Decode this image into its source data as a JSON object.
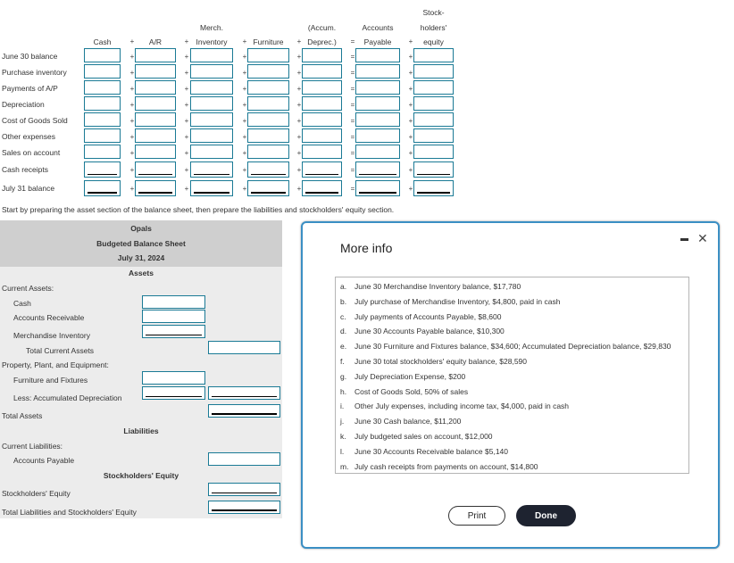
{
  "worksheet": {
    "headers": [
      {
        "lines": [
          "",
          "",
          "Cash"
        ]
      },
      {
        "lines": [
          "",
          "",
          "A/R"
        ]
      },
      {
        "lines": [
          "",
          "Merch.",
          "Inventory"
        ]
      },
      {
        "lines": [
          "",
          "",
          "Furniture"
        ]
      },
      {
        "lines": [
          "",
          "(Accum.",
          "Deprec.)"
        ]
      },
      {
        "lines": [
          "",
          "Accounts",
          "Payable"
        ]
      },
      {
        "lines": [
          "Stock-",
          "holders'",
          "equity"
        ]
      }
    ],
    "operators": [
      "+",
      "+",
      "+",
      "+",
      "=",
      "+"
    ],
    "rows": [
      {
        "label": "June 30 balance"
      },
      {
        "label": "Purchase inventory"
      },
      {
        "label": "Payments of A/P"
      },
      {
        "label": "Depreciation"
      },
      {
        "label": "Cost of Goods Sold"
      },
      {
        "label": "Other expenses"
      },
      {
        "label": "Sales on account"
      },
      {
        "label": "Cash receipts"
      },
      {
        "label": "July 31 balance"
      }
    ],
    "instruction": "Start by preparing the asset section of the balance sheet, then prepare the liabilities and stockholders' equity section."
  },
  "balance_sheet": {
    "company": "Opals",
    "title": "Budgeted Balance Sheet",
    "date": "July 31, 2024",
    "assets_heading": "Assets",
    "current_assets_label": "Current Assets:",
    "cash_label": "Cash",
    "ar_label": "Accounts Receivable",
    "merch_label": "Merchandise Inventory",
    "total_current_label": "Total Current Assets",
    "ppe_label": "Property, Plant, and Equipment:",
    "furniture_label": "Furniture and Fixtures",
    "accum_label": "Less: Accumulated Depreciation",
    "total_assets_label": "Total Assets",
    "liabilities_heading": "Liabilities",
    "current_liab_label": "Current Liabilities:",
    "ap_label": "Accounts Payable",
    "se_heading": "Stockholders' Equity",
    "se_label": "Stockholders' Equity",
    "total_le_label": "Total Liabilities and Stockholders' Equity"
  },
  "modal": {
    "title": "More info",
    "items": [
      {
        "letter": "a.",
        "text": "June 30 Merchandise Inventory balance, $17,780"
      },
      {
        "letter": "b.",
        "text": "July purchase of Merchandise Inventory, $4,800, paid in cash"
      },
      {
        "letter": "c.",
        "text": "July payments of Accounts Payable, $8,600"
      },
      {
        "letter": "d.",
        "text": "June 30 Accounts Payable balance, $10,300"
      },
      {
        "letter": "e.",
        "text": "June 30 Furniture and Fixtures balance, $34,600; Accumulated Depreciation balance, $29,830"
      },
      {
        "letter": "f.",
        "text": "June 30 total stockholders' equity balance, $28,590"
      },
      {
        "letter": "g.",
        "text": "July Depreciation Expense, $200"
      },
      {
        "letter": "h.",
        "text": "Cost of Goods Sold, 50% of sales"
      },
      {
        "letter": "i.",
        "text": "Other July expenses, including income tax, $4,000, paid in cash"
      },
      {
        "letter": "j.",
        "text": "June 30 Cash balance, $11,200"
      },
      {
        "letter": "k.",
        "text": "July budgeted sales on account, $12,000"
      },
      {
        "letter": "l.",
        "text": "June 30 Accounts Receivable balance $5,140"
      },
      {
        "letter": "m.",
        "text": "July cash receipts from payments on account, $14,800"
      }
    ],
    "print_label": "Print",
    "done_label": "Done",
    "minimize_icon": "minimize-icon",
    "close_icon": "close-icon",
    "close_glyph": "✕"
  }
}
